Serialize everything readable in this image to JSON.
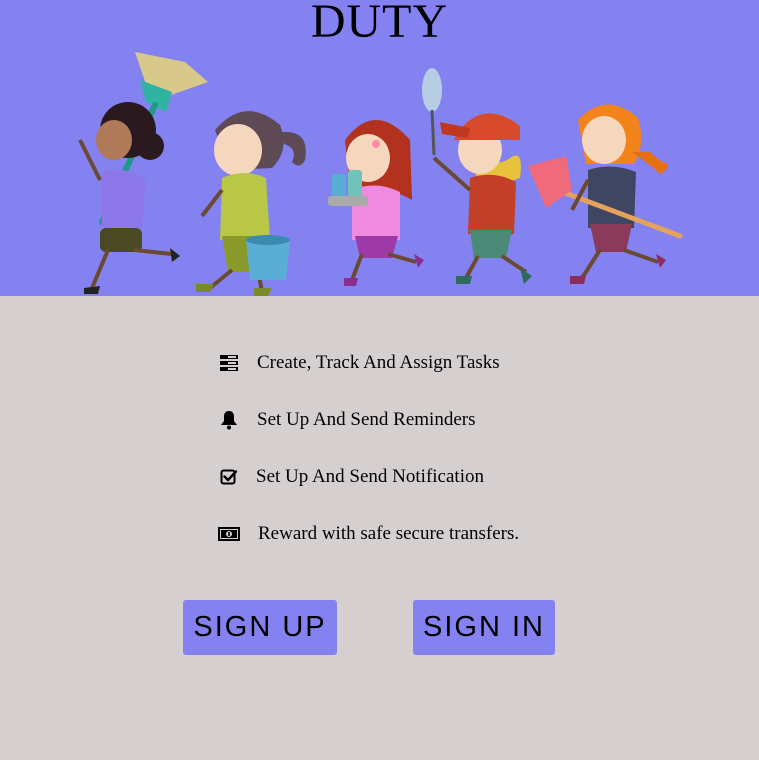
{
  "header": {
    "title": "DUTY",
    "background_color": "#8482f0"
  },
  "page": {
    "background_color": "#d6cfcf"
  },
  "features": [
    {
      "icon": "list-icon",
      "label": "Create, Track And Assign Tasks"
    },
    {
      "icon": "bell-icon",
      "label": "Set Up And Send Reminders"
    },
    {
      "icon": "check-square-icon",
      "label": "Set Up And Send Notification"
    },
    {
      "icon": "money-bill-icon",
      "label": "Reward with safe secure transfers."
    }
  ],
  "actions": {
    "sign_up_label": "SIGN UP",
    "sign_in_label": "SIGN IN",
    "button_color": "#8482f0"
  }
}
